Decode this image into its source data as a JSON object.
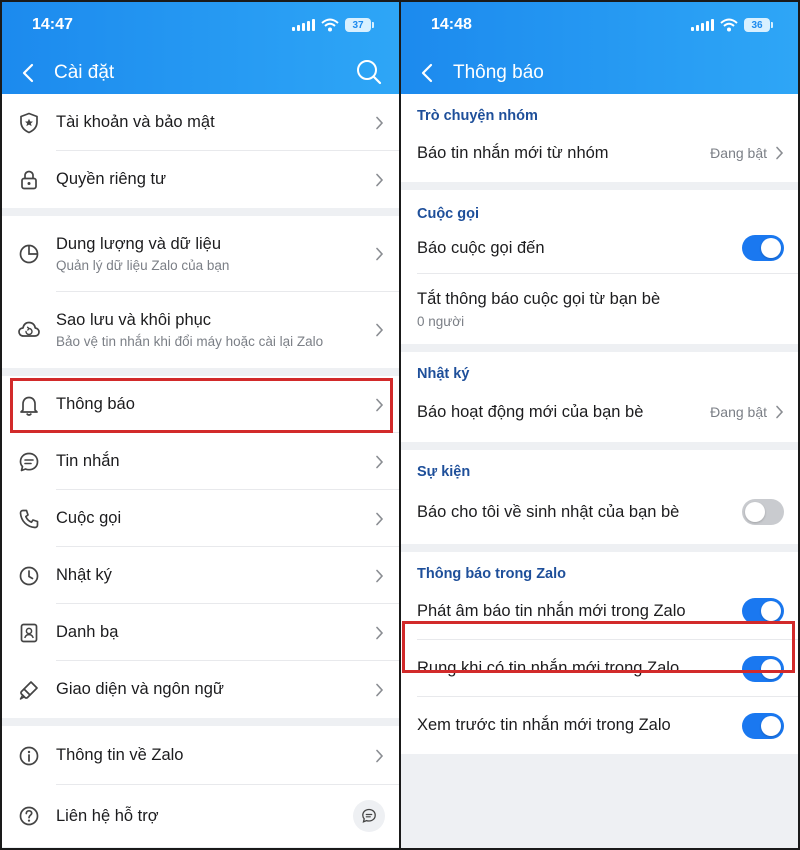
{
  "colors": {
    "header_start": "#1c8aee",
    "header_end": "#2ea6f6",
    "toggle_on": "#1a78f0",
    "toggle_off": "#c9cbcf",
    "highlight": "#d22a2a",
    "section_heading": "#1e4f9a"
  },
  "left": {
    "status": {
      "time": "14:47",
      "battery": "37"
    },
    "header": {
      "title": "Cài đặt",
      "back_icon": "chevron-left-icon",
      "search_icon": "search-icon"
    },
    "groups": [
      [
        {
          "icon": "shield-star-icon",
          "label": "Tài khoản và bảo mật"
        },
        {
          "icon": "lock-icon",
          "label": "Quyền riêng tư"
        }
      ],
      [
        {
          "icon": "pie-chart-icon",
          "label": "Dung lượng và dữ liệu",
          "sub": "Quản lý dữ liệu Zalo của bạn"
        },
        {
          "icon": "cloud-restore-icon",
          "label": "Sao lưu và khôi phục",
          "sub": "Bảo vệ tin nhắn khi đổi máy hoặc cài lại Zalo"
        }
      ],
      [
        {
          "icon": "bell-icon",
          "label": "Thông báo"
        },
        {
          "icon": "chat-bubble-icon",
          "label": "Tin nhắn"
        },
        {
          "icon": "phone-icon",
          "label": "Cuộc gọi"
        },
        {
          "icon": "clock-icon",
          "label": "Nhật ký"
        },
        {
          "icon": "contacts-icon",
          "label": "Danh bạ"
        },
        {
          "icon": "paintbrush-icon",
          "label": "Giao diện và ngôn ngữ"
        }
      ],
      [
        {
          "icon": "info-icon",
          "label": "Thông tin về Zalo"
        },
        {
          "icon": "help-icon",
          "label": "Liên hệ hỗ trợ"
        }
      ]
    ]
  },
  "right": {
    "status": {
      "time": "14:48",
      "battery": "36"
    },
    "header": {
      "title": "Thông báo",
      "back_icon": "chevron-left-icon"
    },
    "sections": [
      {
        "heading": "Trò chuyện nhóm",
        "rows": [
          {
            "label": "Báo tin nhắn mới từ nhóm",
            "status": "Đang bật"
          }
        ]
      },
      {
        "heading": "Cuộc gọi",
        "rows": [
          {
            "label": "Báo cuộc gọi đến",
            "toggle": true
          },
          {
            "label": "Tắt thông báo cuộc gọi từ bạn bè",
            "sub": "0 người"
          }
        ]
      },
      {
        "heading": "Nhật ký",
        "rows": [
          {
            "label": "Báo hoạt động mới của bạn bè",
            "status": "Đang bật"
          }
        ]
      },
      {
        "heading": "Sự kiện",
        "rows": [
          {
            "label": "Báo cho tôi về sinh nhật của bạn bè",
            "toggle": false
          }
        ]
      },
      {
        "heading": "Thông báo trong Zalo",
        "rows": [
          {
            "label": "Phát âm báo tin nhắn mới trong Zalo",
            "toggle": true
          },
          {
            "label": "Rung khi có tin nhắn mới trong Zalo",
            "toggle": true
          },
          {
            "label": "Xem trước tin nhắn mới trong Zalo",
            "toggle": true
          }
        ]
      }
    ]
  }
}
